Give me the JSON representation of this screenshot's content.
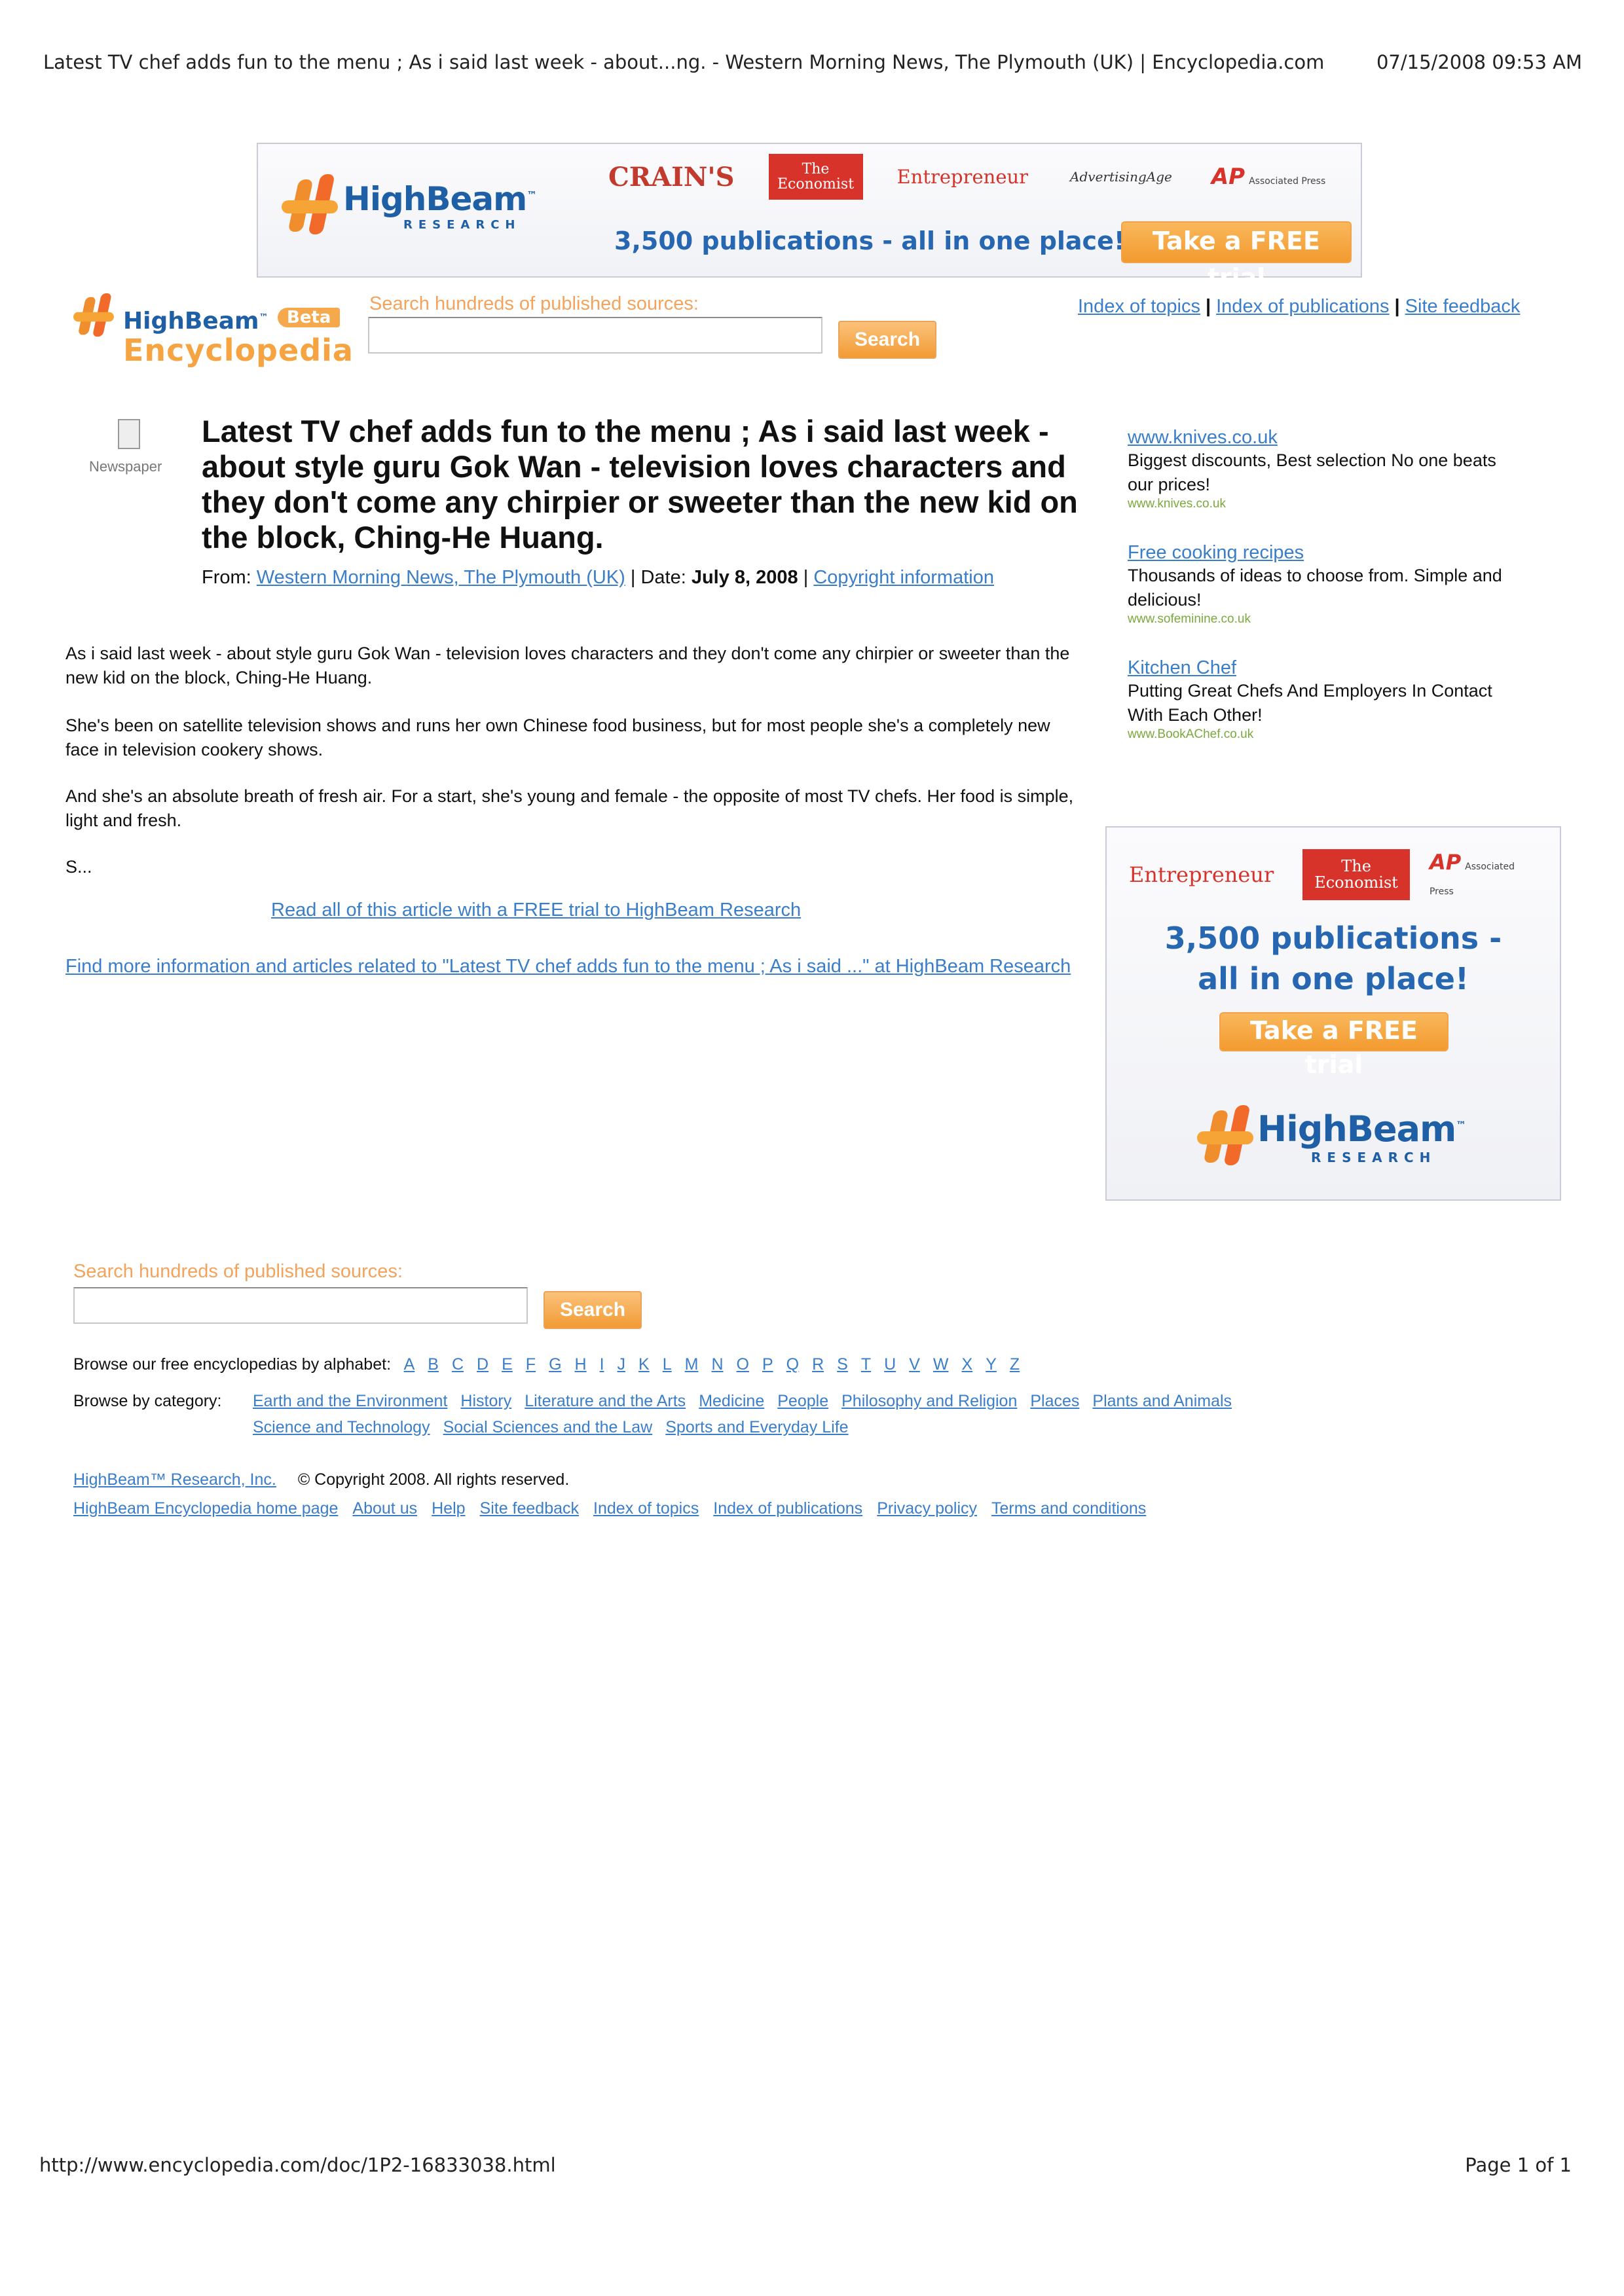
{
  "print_header": {
    "title": "Latest TV chef adds fun to the menu ; As i said last week - about...ng. - Western Morning News, The Plymouth (UK) | Encyclopedia.com",
    "datetime": "07/15/2008 09:53 AM"
  },
  "banner": {
    "brand": "HighBeam",
    "brand_tm": "™",
    "brand_sub": "RESEARCH",
    "publications": [
      "CRAIN'S",
      "The Economist",
      "Entrepreneur",
      "AdvertisingAge",
      "AP",
      "Associated Press"
    ],
    "tagline": "3,500 publications - all in one place!",
    "cta": "Take a FREE trial"
  },
  "header": {
    "logo_brand": "HighBeam",
    "logo_tm": "™",
    "logo_beta": "Beta",
    "logo_product": "Encyclopedia",
    "search_label": "Search hundreds of published sources:",
    "search_value": "",
    "search_button": "Search",
    "links": [
      "Index of topics",
      "Index of publications",
      "Site feedback"
    ]
  },
  "article": {
    "type_label": "Newspaper",
    "title": "Latest TV chef adds fun to the menu ; As i said last week - about style guru Gok Wan - television loves characters and they don't come any chirpier or sweeter than the new kid on the block, Ching-He Huang.",
    "from_label": "From:",
    "source": "Western Morning News, The Plymouth (UK)",
    "date_label": "Date:",
    "date": "July 8, 2008",
    "copyright_link": "Copyright information",
    "paragraphs": [
      "As i said last week - about style guru Gok Wan - television loves characters and they don't come any chirpier or sweeter than the new kid on the block, Ching-He Huang.",
      "She's been on satellite television shows and runs her own Chinese food business, but for most people she's a completely new face in television cookery shows.",
      "And she's an absolute breath of fresh air. For a start, she's young and female - the opposite of most TV chefs. Her food is simple, light and fresh.",
      "S..."
    ],
    "read_all_link": "Read all of this article with a FREE trial to HighBeam Research",
    "find_more_link": "Find more information and articles related to \"Latest TV chef adds fun to the menu ; As i said ...\" at HighBeam Research"
  },
  "sidebar_ads": [
    {
      "title": "www.knives.co.uk",
      "desc": "Biggest discounts, Best selection No one beats our prices!",
      "url": "www.knives.co.uk"
    },
    {
      "title": "Free cooking recipes",
      "desc": "Thousands of ideas to choose from. Simple and delicious!",
      "url": "www.sofeminine.co.uk"
    },
    {
      "title": "Kitchen Chef",
      "desc": "Putting Great Chefs And Employers In Contact With Each Other!",
      "url": "www.BookAChef.co.uk"
    }
  ],
  "box_ad": {
    "publications": [
      "Entrepreneur",
      "The Economist",
      "AP",
      "Associated Press"
    ],
    "tagline_1": "3,500 publications -",
    "tagline_2": "all in one place!",
    "cta": "Take a FREE trial",
    "brand": "HighBeam",
    "brand_tm": "™",
    "brand_sub": "RESEARCH"
  },
  "bottom_search": {
    "label": "Search hundreds of published sources:",
    "value": "",
    "button": "Search"
  },
  "browse": {
    "alphabet_label": "Browse our free encyclopedias by alphabet:",
    "letters": [
      "A",
      "B",
      "C",
      "D",
      "E",
      "F",
      "G",
      "H",
      "I",
      "J",
      "K",
      "L",
      "M",
      "N",
      "O",
      "P",
      "Q",
      "R",
      "S",
      "T",
      "U",
      "V",
      "W",
      "X",
      "Y",
      "Z"
    ],
    "category_label": "Browse by category:",
    "categories_row1": [
      "Earth and the Environment",
      "History",
      "Literature and the Arts",
      "Medicine",
      "People",
      "Philosophy and Religion",
      "Places",
      "Plants and Animals"
    ],
    "categories_row2": [
      "Science and Technology",
      "Social Sciences and the Law",
      "Sports and Everyday Life"
    ]
  },
  "footer": {
    "company_link": "HighBeam™ Research, Inc.",
    "copyright": "© Copyright 2008. All rights reserved.",
    "links": [
      "HighBeam Encyclopedia home page",
      "About us",
      "Help",
      "Site feedback",
      "Index of topics",
      "Index of publications",
      "Privacy policy",
      "Terms and conditions"
    ]
  },
  "print_footer": {
    "url": "http://www.encyclopedia.com/doc/1P2-16833038.html",
    "page": "Page 1 of 1"
  },
  "colors": {
    "link": "#3a7ec9",
    "brand_blue": "#1f5fa6",
    "brand_orange": "#f39a2f",
    "search_label": "#f3a35c",
    "ad_url_green": "#7aa93c"
  }
}
